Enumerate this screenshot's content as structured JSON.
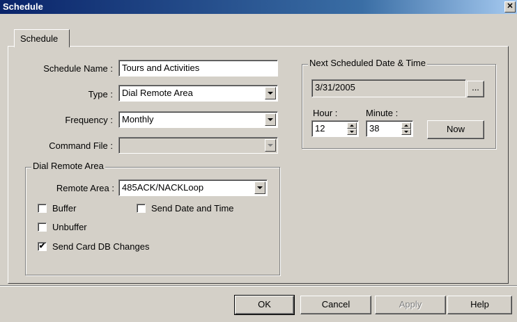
{
  "window": {
    "title": "Schedule",
    "close_glyph": "✕"
  },
  "tabs": [
    {
      "label": "Schedule"
    }
  ],
  "form": {
    "schedule_name_label": "Schedule Name :",
    "schedule_name_value": "Tours and Activities",
    "type_label": "Type :",
    "type_value": "Dial Remote Area",
    "frequency_label": "Frequency :",
    "frequency_value": "Monthly",
    "command_file_label": "Command File :",
    "command_file_value": ""
  },
  "dial_remote_area": {
    "group_title": "Dial Remote Area",
    "remote_area_label": "Remote Area :",
    "remote_area_value": "485ACK/NACKLoop",
    "buffer_label": "Buffer",
    "buffer_checked": false,
    "send_date_time_label": "Send Date and Time",
    "send_date_time_checked": false,
    "unbuffer_label": "Unbuffer",
    "unbuffer_checked": false,
    "send_card_db_label": "Send Card DB Changes",
    "send_card_db_checked": true,
    "check_glyph": "✔"
  },
  "next_scheduled": {
    "group_title": "Next Scheduled Date & Time",
    "date_value": "3/31/2005",
    "date_button_label": "...",
    "hour_label": "Hour :",
    "hour_value": "12",
    "minute_label": "Minute :",
    "minute_value": "38",
    "now_button_label": "Now"
  },
  "buttons": {
    "ok_label": "OK",
    "cancel_label": "Cancel",
    "apply_label": "Apply",
    "help_label": "Help"
  }
}
